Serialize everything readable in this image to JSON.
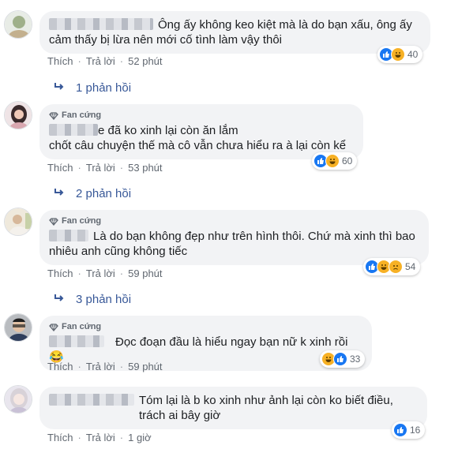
{
  "comments": [
    {
      "badge": "",
      "line1": "Ông ấy không keo kiệt mà là do bạn xấu, ông ấy",
      "line2": "cảm thấy bị lừa nên mới cố tình làm vậy thôi",
      "like": "Thích",
      "reply": "Trả lời",
      "time": "52 phút",
      "count": "40",
      "replies": "1 phản hồi"
    },
    {
      "badge": "Fan cứng",
      "line1": "e đã ko xinh lại còn ăn lắm",
      "line2": "chốt câu chuyện thế mà cô vẫn chưa hiểu ra à lại còn kể",
      "like": "Thích",
      "reply": "Trả lời",
      "time": "53 phút",
      "count": "60",
      "replies": "2 phản hồi"
    },
    {
      "badge": "Fan cứng",
      "line1": "Là do bạn không đẹp như trên hình thôi. Chứ mà xinh thì bao",
      "line2": "nhiêu anh cũng không tiếc",
      "like": "Thích",
      "reply": "Trả lời",
      "time": "59 phút",
      "count": "54",
      "replies": "3 phản hồi"
    },
    {
      "badge": "Fan cứng",
      "line1": "Đọc đoạn đầu là hiểu ngay bạn nữ k xinh rồi 😂",
      "line2": "",
      "like": "Thích",
      "reply": "Trả lời",
      "time": "59 phút",
      "count": "33",
      "replies": ""
    },
    {
      "badge": "",
      "line1": "Tóm lại là b ko xinh như ảnh lại còn ko biết điều,",
      "line2": "trách ai bây giờ",
      "like": "Thích",
      "reply": "Trả lời",
      "time": "1 giờ",
      "count": "16",
      "replies": ""
    }
  ],
  "colors": {
    "bubble": "#f2f3f5",
    "link": "#385898",
    "like": "#1877f2",
    "haha": "#f7b125",
    "muted": "#606770"
  },
  "icons": [
    "avatar",
    "diamond-icon",
    "like-icon",
    "haha-icon",
    "sad-icon",
    "reply-arrow-icon"
  ]
}
